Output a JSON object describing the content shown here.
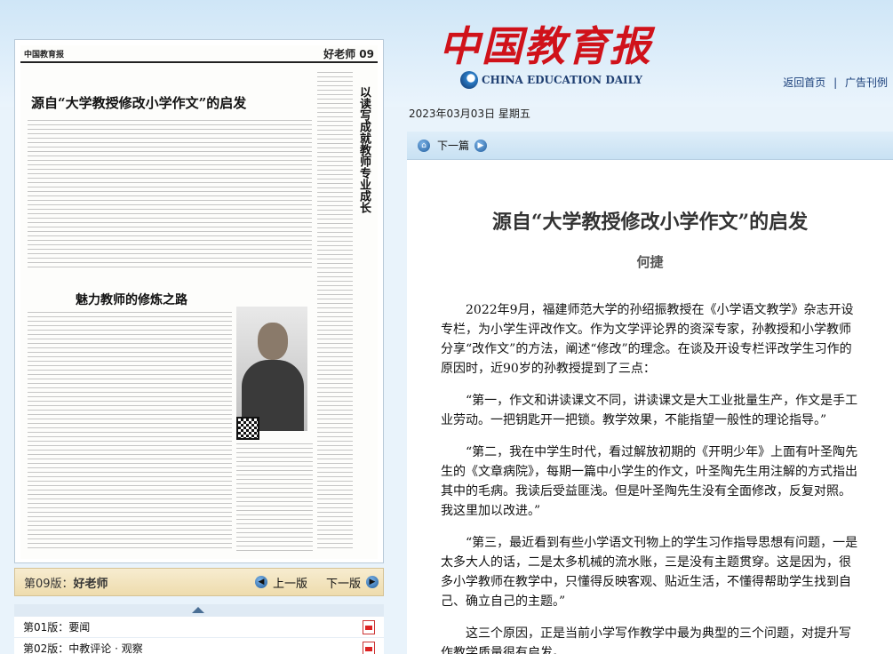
{
  "header": {
    "logo_cn": "中国教育报",
    "logo_en": "CHINA EDUCATION DAILY",
    "links": [
      "返回首页",
      "广告刊例"
    ],
    "separator": "|",
    "date": "2023年03月03日  星期五"
  },
  "paper": {
    "masthead": "中国教育报",
    "page_label": "好老师 09",
    "headline1": "源自“大学教授修改小学作文”的启发",
    "headline2": "魅力教师的修炼之路",
    "side_column_title": "以读写成就教师专业成长"
  },
  "edition_bar": {
    "label_prefix": "第09版：",
    "label_name": "好老师",
    "prev_label": "上一版",
    "next_label": "下一版"
  },
  "page_list": [
    {
      "label": "第01版：要闻"
    },
    {
      "label": "第02版：中教评论 · 观察"
    }
  ],
  "article_nav": {
    "next_label": "下一篇"
  },
  "article": {
    "title": "源自“大学教授修改小学作文”的启发",
    "author": "何捷",
    "paragraphs": [
      "2022年9月，福建师范大学的孙绍振教授在《小学语文教学》杂志开设专栏，为小学生评改作文。作为文学评论界的资深专家，孙教授和小学教师分享“改作文”的方法，阐述“修改”的理念。在谈及开设专栏评改学生习作的原因时，近90岁的孙教授提到了三点：",
      "“第一，作文和讲读课文不同，讲读课文是大工业批量生产，作文是手工业劳动。一把钥匙开一把锁。教学效果，不能指望一般性的理论指导。”",
      "“第二，我在中学生时代，看过解放初期的《开明少年》上面有叶圣陶先生的《文章病院》，每期一篇中小学生的作文，叶圣陶先生用注解的方式指出其中的毛病。我读后受益匪浅。但是叶圣陶先生没有全面修改，反复对照。我这里加以改进。”",
      "“第三，最近看到有些小学语文刊物上的学生习作指导思想有问题，一是太多大人的话，二是太多机械的流水账，三是没有主题贯穿。这是因为，很多小学教师在教学中，只懂得反映客观、贴近生活，不懂得帮助学生找到自己、确立自己的主题。”",
      "这三个原因，正是当前小学写作教学中最为典型的三个问题，对提升写作教学质量很有启发。"
    ]
  }
}
